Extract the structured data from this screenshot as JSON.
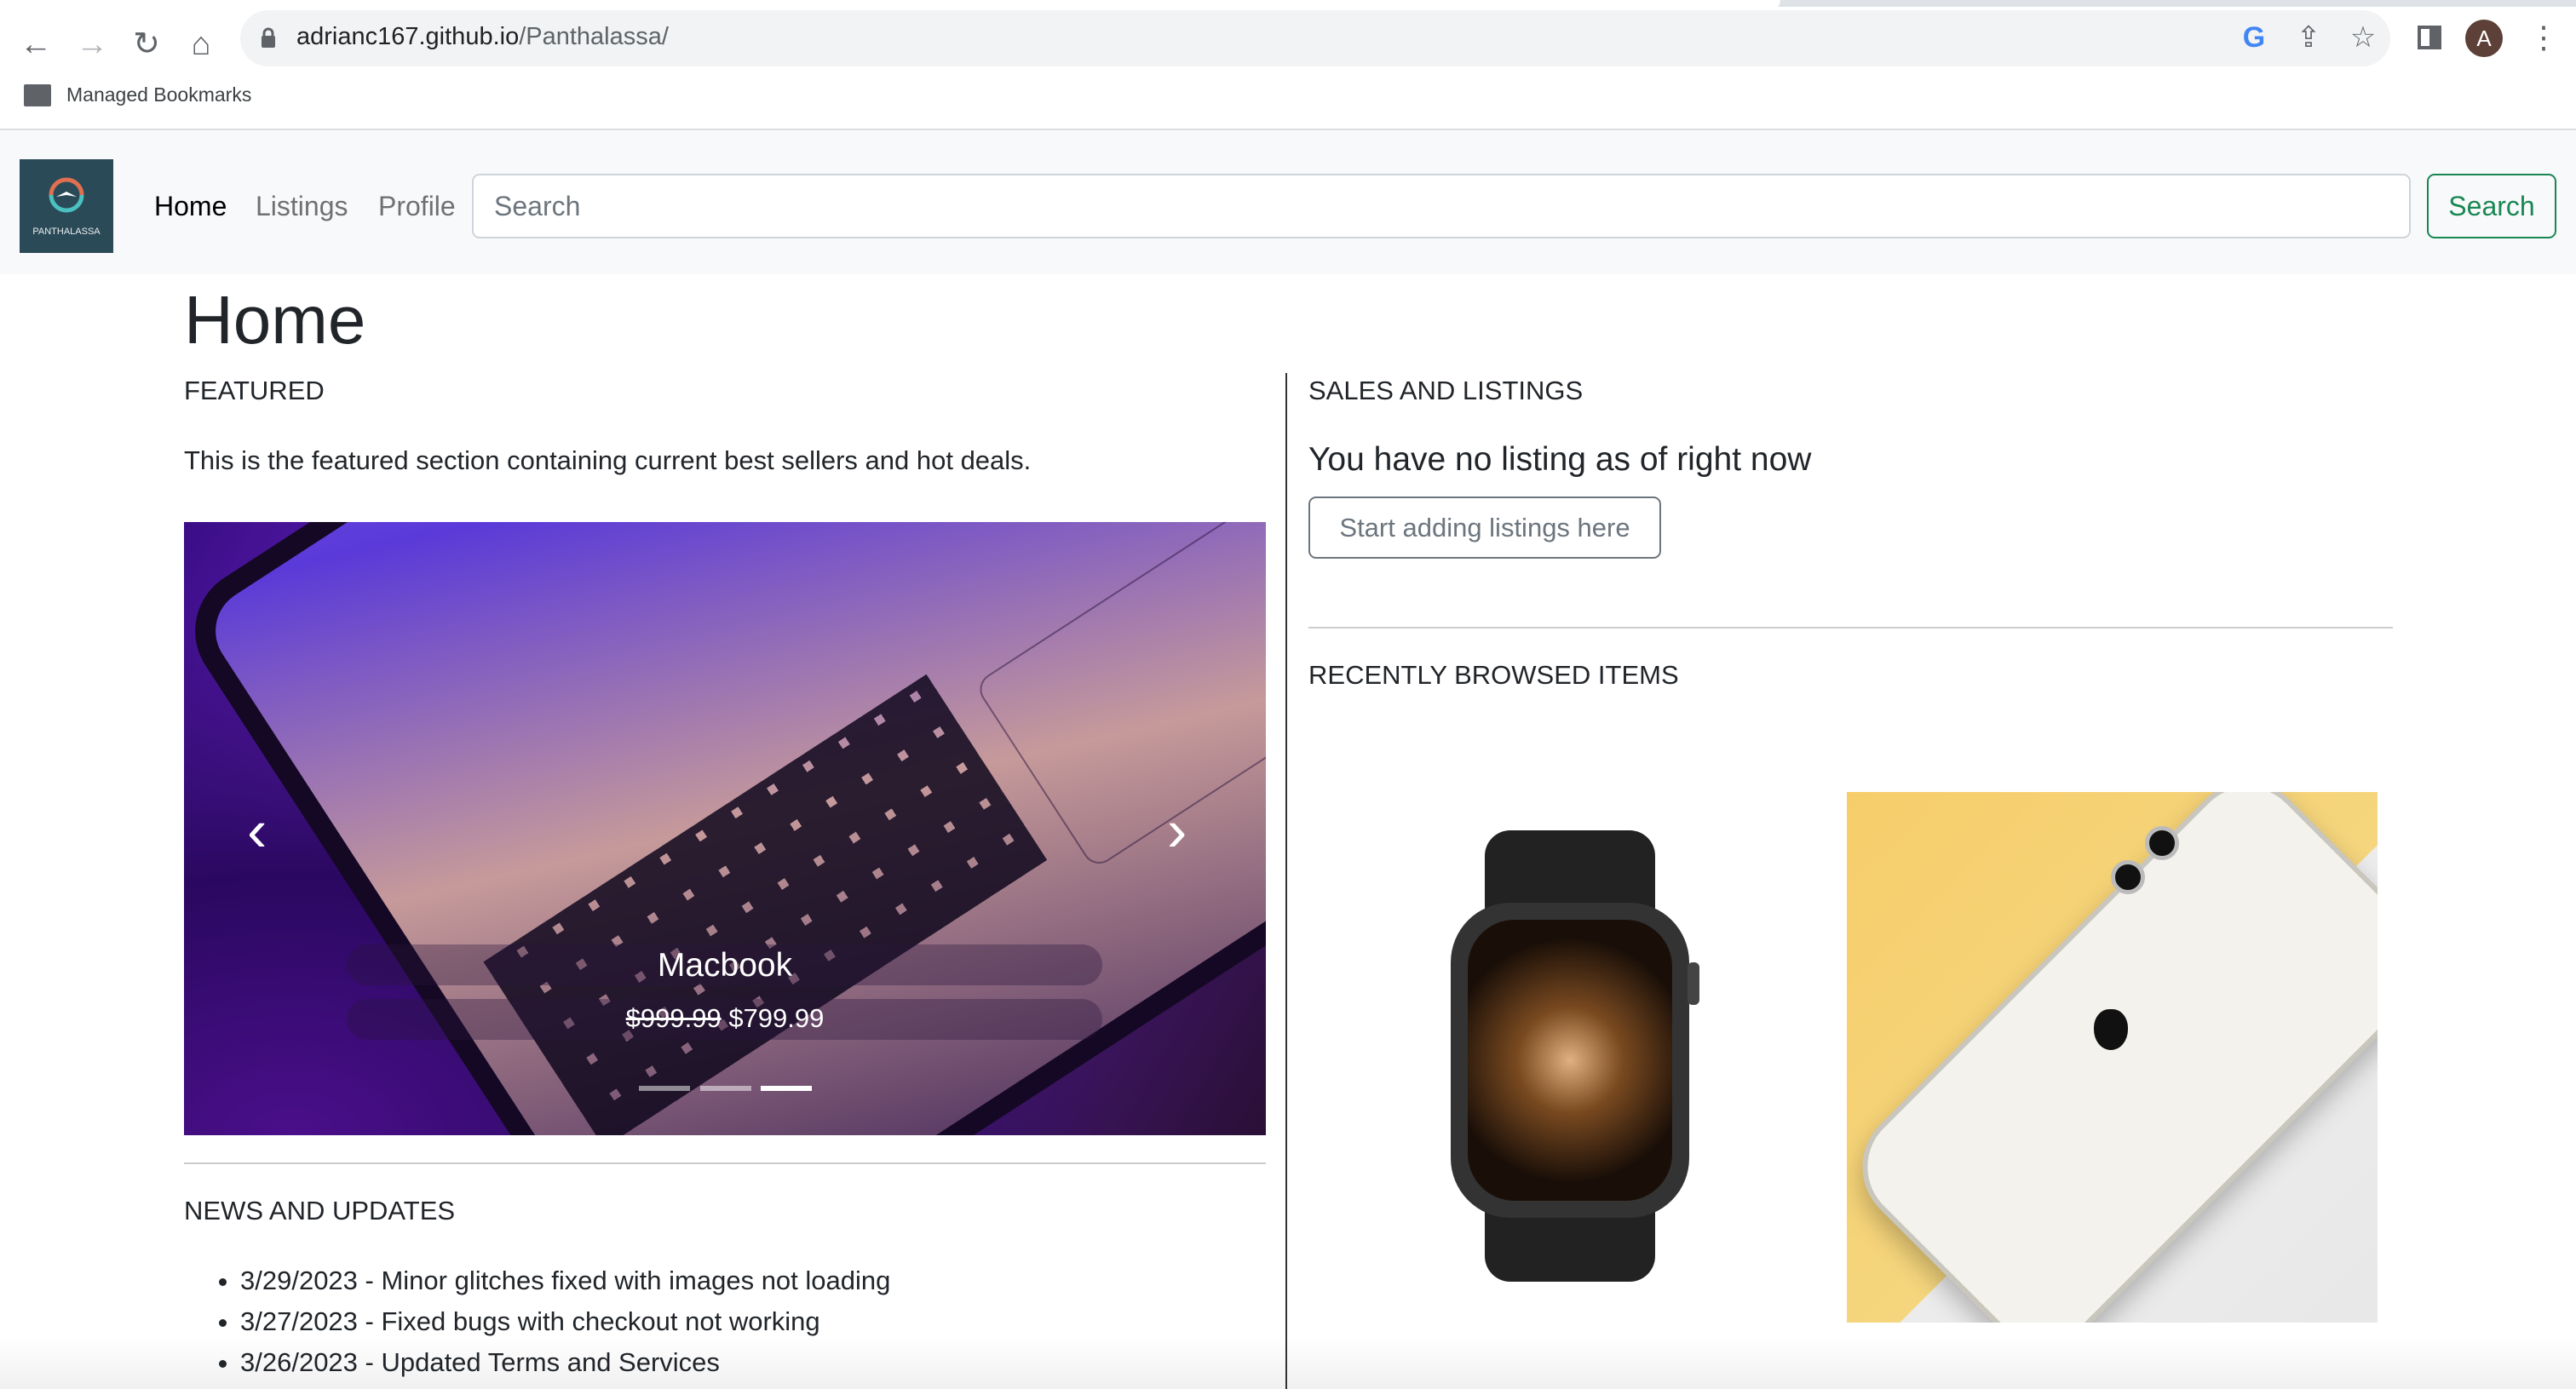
{
  "browser": {
    "url_domain": "adrianc167.github.io",
    "url_path": "/Panthalassa/",
    "bookmarks_folder": "Managed Bookmarks",
    "profile_initial": "A"
  },
  "navbar": {
    "logo_text": "PANTHALASSA",
    "links": [
      "Home",
      "Listings",
      "Profile"
    ],
    "search_placeholder": "Search",
    "search_button": "Search"
  },
  "page": {
    "title": "Home",
    "featured": {
      "heading": "FEATURED",
      "description": "This is the featured section containing current best sellers and hot deals.",
      "carousel": {
        "title": "Macbook",
        "old_price": "$999.99",
        "new_price": "$799.99",
        "slide_count": 3,
        "active_slide": 3
      }
    },
    "news": {
      "heading": "NEWS AND UPDATES",
      "items": [
        "3/29/2023 - Minor glitches fixed with images not loading",
        "3/27/2023 - Fixed bugs with checkout not working",
        "3/26/2023 - Updated Terms and Services"
      ]
    },
    "sales": {
      "heading": "SALES AND LISTINGS",
      "empty_message": "You have no listing as of right now",
      "add_button": "Start adding listings here"
    },
    "recent": {
      "heading": "RECENTLY BROWSED ITEMS"
    }
  },
  "colors": {
    "success": "#198754",
    "navbar_bg": "#f8f9fa",
    "avatar": "#5d4037"
  }
}
